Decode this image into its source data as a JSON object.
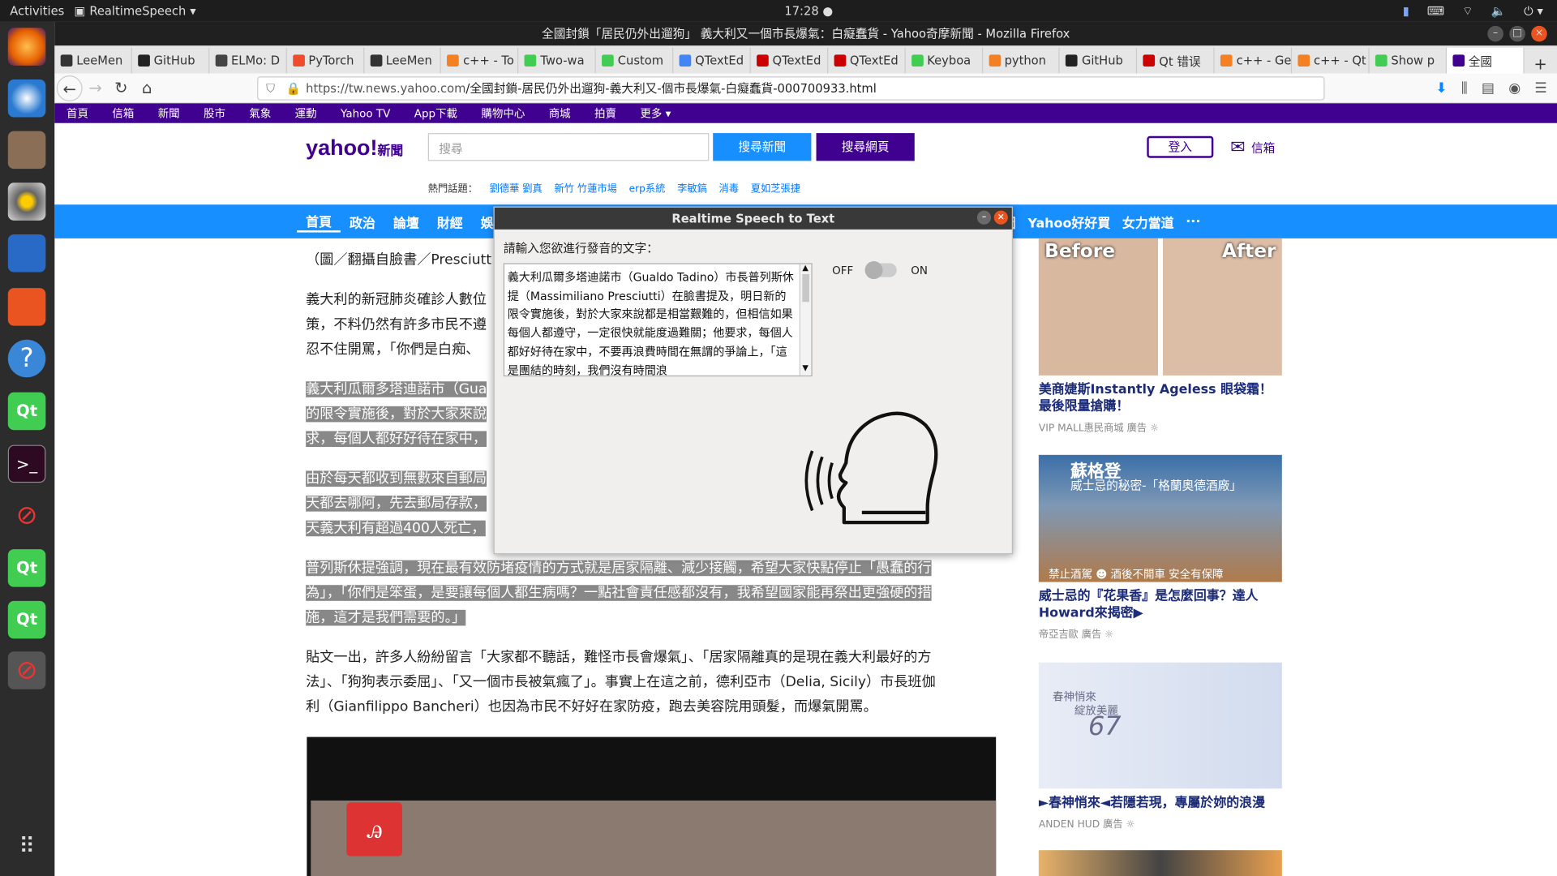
{
  "topbar": {
    "activities": "Activities",
    "app_name": "RealtimeSpeech",
    "clock": "17:28 ●"
  },
  "window_title": "全國封鎖「居民仍外出遛狗」 義大利又一個市長爆氣：白癡蠢貨 - Yahoo奇摩新聞 - Mozilla Firefox",
  "tabs": [
    {
      "label": "LeeMen",
      "color": "#333"
    },
    {
      "label": "GitHub",
      "color": "#222"
    },
    {
      "label": "ELMo: D",
      "color": "#444"
    },
    {
      "label": "PyTorch",
      "color": "#ee4c2c"
    },
    {
      "label": "LeeMen",
      "color": "#333"
    },
    {
      "label": "c++ - To",
      "color": "#f48024"
    },
    {
      "label": "Two-wa",
      "color": "#41cd52"
    },
    {
      "label": "Custom",
      "color": "#41cd52"
    },
    {
      "label": "QTextEd",
      "color": "#4285f4"
    },
    {
      "label": "QTextEd",
      "color": "#c00"
    },
    {
      "label": "QTextEd",
      "color": "#c00"
    },
    {
      "label": "Keyboa",
      "color": "#41cd52"
    },
    {
      "label": "python",
      "color": "#f48024"
    },
    {
      "label": "GitHub",
      "color": "#222"
    },
    {
      "label": "Qt 错误",
      "color": "#c00"
    },
    {
      "label": "c++ - Ge",
      "color": "#f48024"
    },
    {
      "label": "c++ - Qt",
      "color": "#f48024"
    },
    {
      "label": "Show p",
      "color": "#41cd52"
    },
    {
      "label": "全國",
      "color": "#400090"
    }
  ],
  "url": {
    "host": "https://tw.news.yahoo.com",
    "path": "/全國封鎖-居民仍外出遛狗-義大利又-個市長爆氣-白癡蠢貨-000700933.html"
  },
  "ynav": [
    "首頁",
    "信箱",
    "新聞",
    "股市",
    "氣象",
    "運動",
    "Yahoo TV",
    "App下載",
    "購物中心",
    "商城",
    "拍賣",
    "更多 ▾"
  ],
  "yahoo": {
    "logo": "yahoo!",
    "logo_sub": "新聞",
    "search_placeholder": "搜尋",
    "search_news": "搜尋新聞",
    "search_web": "搜尋網頁",
    "login": "登入",
    "mail": "信箱",
    "hot_label": "熱門話題：",
    "hot_topics": [
      "劉德華 劉真",
      "新竹 竹蓮市場",
      "erp系統",
      "李敏鎬",
      "消毒",
      "夏如芝張捷"
    ]
  },
  "categories": [
    "首頁",
    "政治",
    "論壇",
    "財經",
    "娛樂"
  ],
  "categories_right": [
    "圖",
    "Yahoo好好買",
    "女力當道",
    "···"
  ],
  "article": {
    "caption": "（圖／翻攝自臉書／Presciutt",
    "p1": "義大利的新冠肺炎確診人數位",
    "p1b": "策，不料仍然有許多市民不遵",
    "p1c": "忍不住開罵，「你們是白痴、",
    "p2a": "義大利瓜爾多塔迪諾市（Gua",
    "p2b": "的限令實施後，對於大家來說",
    "p2c": "求，每個人都好好待在家中，",
    "p3a": "由於每天都收到無數來自郵局",
    "p3b": "天都去哪阿，先去郵局存款，",
    "p3c": "天義大利有超過400人死亡，",
    "p4a": "普列斯休提強調，現在最有效防堵疫情的方式就是居家隔離、減少接觸，希望大家快點停止「愚蠢的行",
    "p4b": "為」，「你們是笨蛋，是要讓每個人都生病嗎？一點社會責任感都沒有，我希望國家能再祭出更強硬的措",
    "p4c": "施，這才是我們需要的。」",
    "p5a": "貼文一出，許多人紛紛留言「大家都不聽話，難怪市長會爆氣」、「居家隔離真的是現在義大利最好的方",
    "p5b": "法」、「狗狗表示委屈」、「又一個市長被氣瘋了」。事實上在這之前，德利亞市（Delia, Sicily）市長班伽",
    "p5c": "利（Gianfilippo Bancheri）也因為市民不好好在家防疫，跑去美容院用頭髮，而爆氣開罵。"
  },
  "ads": [
    {
      "title": "美商婕斯Instantly Ageless 眼袋霜！最後限量搶購！",
      "source": "VIP MALL惠民商城",
      "tag": "廣告",
      "img_before": "Before",
      "img_after": "After"
    },
    {
      "title": "威士忌的『花果香』是怎麼回事？達人Howard來揭密▶",
      "source": "帝亞吉歐",
      "tag": "廣告",
      "img_text1": "蘇格登",
      "img_text2": "威士忌的秘密-「格蘭奧德酒廠」",
      "img_text3": "禁止酒駕 ☻ 酒後不開車 安全有保障"
    },
    {
      "title": "►春神悄來◄若隱若現，專屬於妳的浪漫",
      "source": "ANDEN HUD",
      "tag": "廣告",
      "img_text1": "春神悄來",
      "img_text2": "綻放美麗",
      "img_text3": "67"
    }
  ],
  "dialog": {
    "title": "Realtime Speech to Text",
    "prompt": "請輸入您欲進行發音的文字：",
    "text": "義大利瓜爾多塔迪諾市（Gualdo Tadino）市長普列斯休提（Massimiliano Presciutti）在臉書提及，明日新的限令實施後，對於大家來說都是相當艱難的，但相信如果每個人都遵守，一定很快就能度過難關；他要求，每個人都好好待在家中，不要再浪費時間在無謂的爭論上，「這是團結的時刻，我們沒有時間浪",
    "off": "OFF",
    "on": "ON",
    "toggle_on": false
  }
}
